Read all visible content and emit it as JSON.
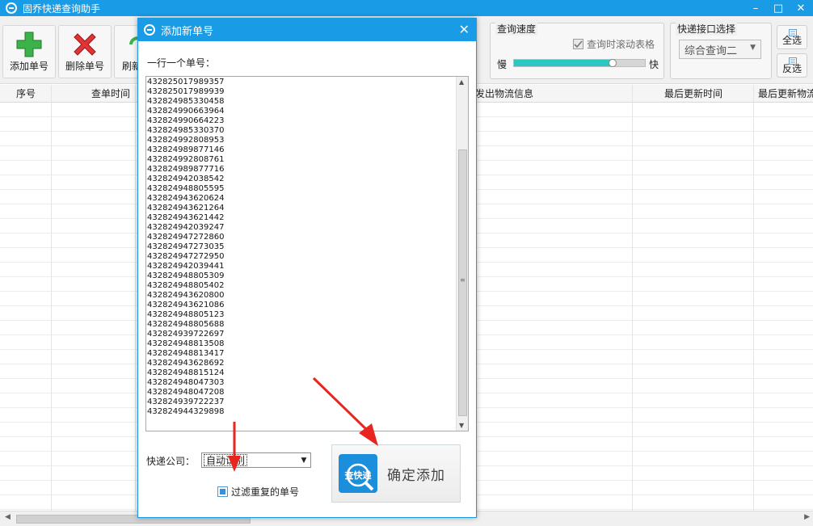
{
  "app": {
    "title": "固乔快递查询助手"
  },
  "toolbar": {
    "add_label": "添加单号",
    "delete_label": "删除单号",
    "refresh_label": "刷新",
    "speed_group_title": "查询速度",
    "scroll_table_label": "查询时滚动表格",
    "slow_label": "慢",
    "fast_label": "快",
    "speed_level_percent": 75,
    "api_group_title": "快递接口选择",
    "api_selected": "综合查询二",
    "select_all_label": "全选",
    "invert_label": "反选"
  },
  "table": {
    "col_index": "序号",
    "col_query_time": "查单时间",
    "col_shipping_info": "发出物流信息",
    "col_last_update": "最后更新时间",
    "col_last_update_info": "最后更新物流"
  },
  "dialog": {
    "title": "添加新单号",
    "instruction": "一行一个单号：",
    "numbers": [
      "432825017989357",
      "432825017989939",
      "432824985330458",
      "432824990663964",
      "432824990664223",
      "432824985330370",
      "432824992808953",
      "432824989877146",
      "432824992808761",
      "432824989877716",
      "432824942038542",
      "432824948805595",
      "432824943620624",
      "432824943621264",
      "432824943621442",
      "432824942039247",
      "432824947272860",
      "432824947273035",
      "432824947272950",
      "432824942039441",
      "432824948805309",
      "432824948805402",
      "432824943620800",
      "432824943621086",
      "432824948805123",
      "432824948805688",
      "432824939722697",
      "432824948813508",
      "432824948813417",
      "432824943628692",
      "432824948815124",
      "432824948047303",
      "432824948047208",
      "432824939722237",
      "432824944329898"
    ],
    "company_label": "快递公司：",
    "company_value": "自动识别",
    "filter_label": "过滤重复的单号",
    "logo_text": "查快递",
    "confirm_label": "确定添加"
  },
  "colors": {
    "title_bar": "#1a9be6",
    "slider_fill": "#2bc7c0",
    "logo_blue": "#1b8fdc"
  }
}
